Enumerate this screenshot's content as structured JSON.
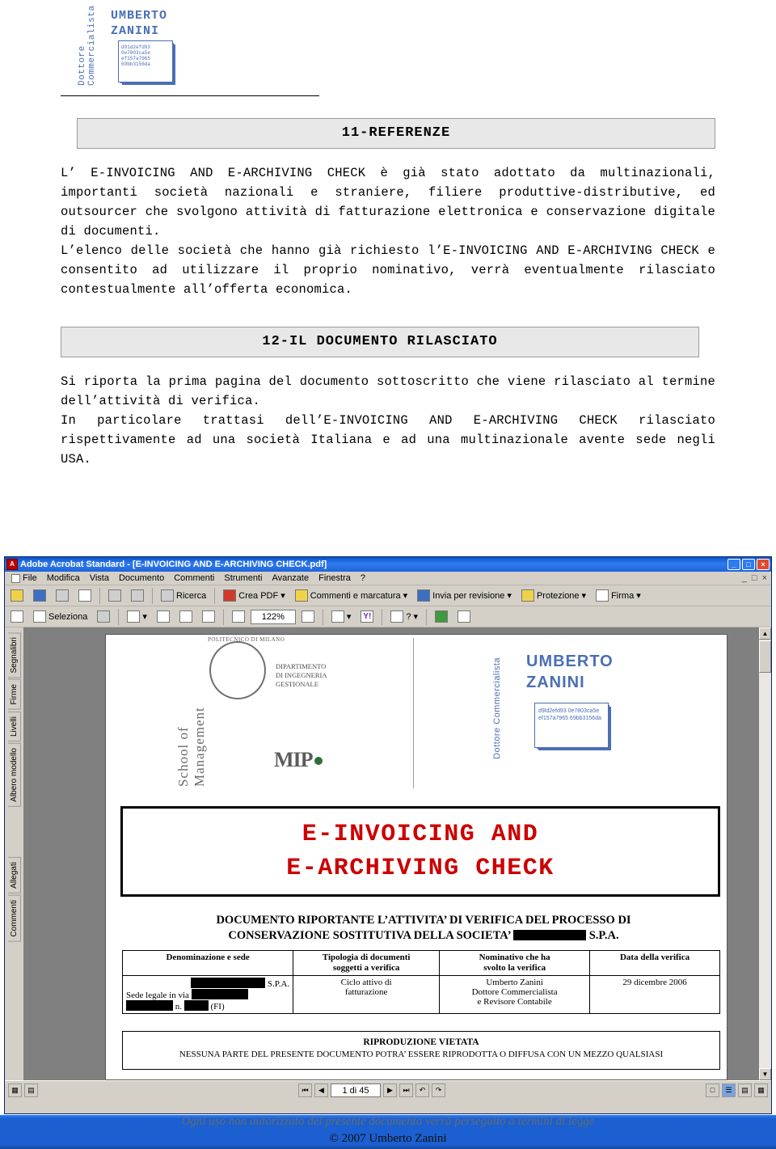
{
  "letterhead": {
    "vertical_text": "Dottore Commercialista",
    "name_line1": "UMBERTO",
    "name_line2": "ZANINI",
    "stamp_text": "d91d2efd93 0e7803ca5e ef157a7965 69bb3156da"
  },
  "sections": [
    {
      "heading": "11-REFERENZE",
      "paragraphs": [
        "L’ E-INVOICING AND E-ARCHIVING CHECK è già stato adottato da multinazionali, importanti società nazionali e straniere, filiere produttive-distributive, ed outsourcer che svolgono attività di fatturazione elettronica e conservazione digitale di documenti.",
        "L’elenco delle società che hanno già richiesto l’E-INVOICING AND E-ARCHIVING CHECK e consentito ad  utilizzare il proprio nominativo, verrà eventualmente rilasciato contestualmente all’offerta economica."
      ]
    },
    {
      "heading": "12-IL DOCUMENTO RILASCIATO",
      "paragraphs": [
        "Si riporta  la prima pagina del documento sottoscritto che viene rilasciato al termine dell’attività di verifica.",
        "In particolare trattasi dell’E-INVOICING AND E-ARCHIVING CHECK rilasciato rispettivamente ad una società Italiana e ad una multinazionale avente sede negli USA."
      ]
    }
  ],
  "acrobat": {
    "title": "Adobe Acrobat Standard - [E-INVOICING AND E-ARCHIVING CHECK.pdf]",
    "window_buttons": [
      "_",
      "□",
      "×"
    ],
    "inner_window_buttons": [
      "_",
      "□",
      "×"
    ],
    "menu": [
      "File",
      "Modifica",
      "Vista",
      "Documento",
      "Commenti",
      "Strumenti",
      "Avanzate",
      "Finestra",
      "?"
    ],
    "toolbar1": [
      "Ricerca",
      "Crea PDF",
      "Commenti e marcatura",
      "Invia per revisione",
      "Protezione",
      "Firma"
    ],
    "toolbar2": {
      "select_label": "Seleziona",
      "zoom_value": "122%",
      "help_label": "?"
    },
    "tabs": [
      "Segnalibri",
      "Firme",
      "Livelli",
      "Albero modello",
      "Allegati",
      "Commenti"
    ],
    "statusbar": {
      "page_value": "1 di 45"
    },
    "pdf": {
      "mip": {
        "school_text": "School of Management",
        "politecnico": "POLITECNICO DI MILANO",
        "dipartimento": "DIPARTIMENTO DI INGEGNERIA GESTIONALE",
        "logo": "MIP"
      },
      "header": {
        "vertical_text": "Dottore Commercialista",
        "name_line1": "UMBERTO",
        "name_line2": "ZANINI",
        "stamp_text": "d9ld2efd93 0e7803ca5e ef157a7965 69bb3156da"
      },
      "title_line1": "E-INVOICING AND",
      "title_line2": "E-ARCHIVING CHECK",
      "subtitle_line1": "DOCUMENTO RIPORTANTE L’ATTIVITA’ DI VERIFICA DEL PROCESSO DI",
      "subtitle_line2_a": "CONSERVAZIONE SOSTITUTIVA DELLA SOCIETA’",
      "subtitle_line2_b": "S.P.A.",
      "table": {
        "headers": [
          "Denominazione e sede",
          "Tipologia di documenti soggetti a verifica",
          "Nominativo che ha svolto la verifica",
          "Data della verifica"
        ],
        "row": [
          "S.P.A.\nSede legale in via\nn.\n(FI)",
          "Ciclo attivo di fatturazione",
          "Umberto Zanini\nDottore Commercialista\ne Revisore Contabile",
          "29 dicembre 2006"
        ],
        "cell_col1_line1": "S.P.A.",
        "cell_col1_line2": "Sede legale in via",
        "cell_col1_line3": "n.",
        "cell_col1_line4": "(FI)",
        "cell_col2_line1": "Ciclo attivo di",
        "cell_col2_line2": "fatturazione",
        "cell_col3_line1": "Umberto Zanini",
        "cell_col3_line2": "Dottore Commercialista",
        "cell_col3_line3": "e Revisore Contabile",
        "cell_col4": "29 dicembre 2006"
      },
      "footer_title": "RIPRODUZIONE VIETATA",
      "footer_text": "NESSUNA PARTE DEL PRESENTE DOCUMENTO POTRA’ ESSERE RIPRODOTTA O DIFFUSA CON UN MEZZO QUALSIASI"
    }
  },
  "page_footer": {
    "line1": "Ogni uso non autorizzato del presente documento verrà perseguito a termini di legge",
    "line2": "© 2007  Umberto Zanini"
  }
}
